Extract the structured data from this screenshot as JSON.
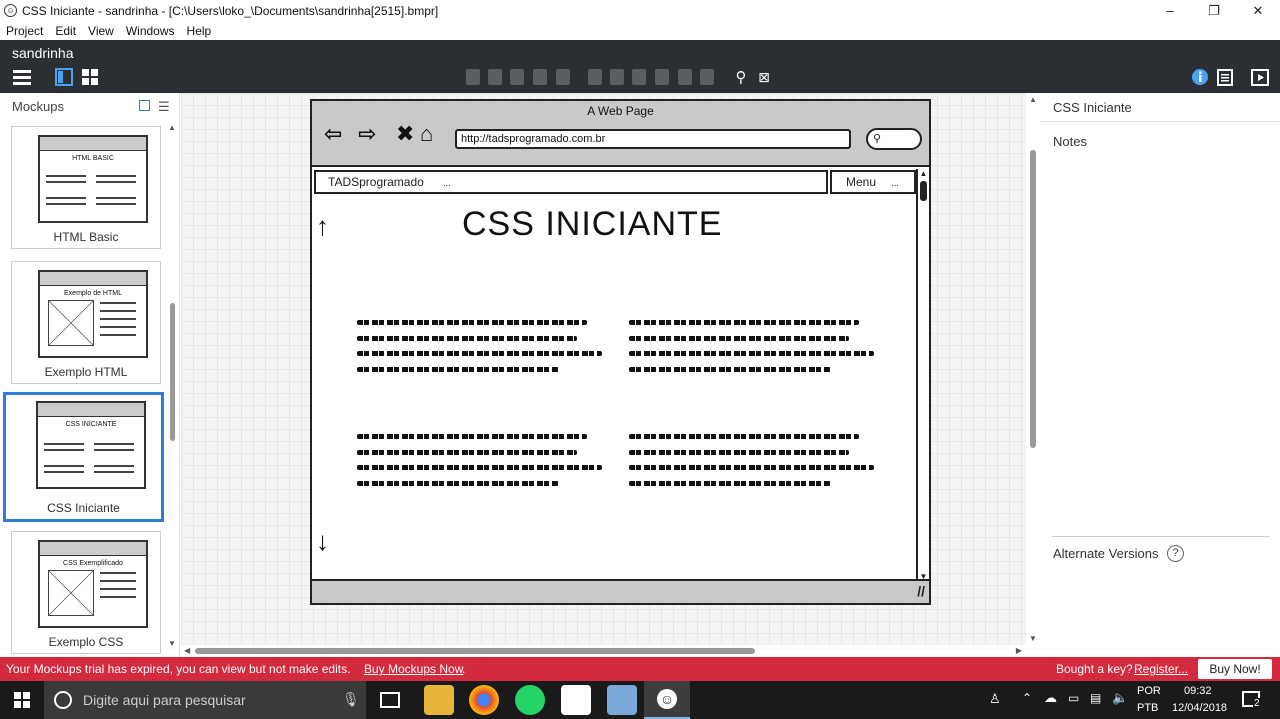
{
  "window": {
    "title": "CSS Iniciante - sandrinha - [C:\\Users\\loko_\\Documents\\sandrinha[2515].bmpr]",
    "minimize": "–",
    "restore": "❐",
    "close": "✕"
  },
  "menu": [
    "Project",
    "Edit",
    "View",
    "Windows",
    "Help"
  ],
  "project_name": "sandrinha",
  "sidebar": {
    "header": "Mockups",
    "thumbnails": [
      {
        "label": "HTML Basic",
        "inner_title": "HTML BASIC",
        "selected": false
      },
      {
        "label": "Exemplo HTML",
        "inner_title": "Exemplo de HTML",
        "selected": false
      },
      {
        "label": "CSS Iniciante",
        "inner_title": "CSS INICIANTE",
        "selected": true
      },
      {
        "label": "Exemplo CSS",
        "inner_title": "CSS Exemplificado",
        "selected": false
      }
    ]
  },
  "mockup": {
    "browser_title": "A Web Page",
    "url": "http://tadsprogramado.com.br",
    "search_icon": "search-icon",
    "tab_left": "TADSprogramado",
    "tab_left_ellipsis": "...",
    "tab_right": "Menu",
    "tab_right_ellipsis": "...",
    "heading": "CSS INICIANTE"
  },
  "right_panel": {
    "title": "CSS Iniciante",
    "notes": "Notes",
    "alternate_versions": "Alternate Versions",
    "help": "?"
  },
  "trial_bar": {
    "message": "Your Mockups trial has expired, you can view but not make edits.",
    "buy_link": "Buy Mockups Now",
    "period": ".",
    "key_question": "Bought a key?",
    "register": "Register...",
    "buy_button": "Buy Now!"
  },
  "taskbar": {
    "search_placeholder": "Digite aqui para pesquisar",
    "lang1": "POR",
    "lang2": "PTB",
    "time": "09:32",
    "date": "12/04/2018",
    "notifications": "2"
  },
  "colors": {
    "accent": "#2d7dd6",
    "dark_toolbar": "#2b2f33",
    "trial_red": "#d42a3d",
    "taskbar": "#1a1a1a"
  }
}
